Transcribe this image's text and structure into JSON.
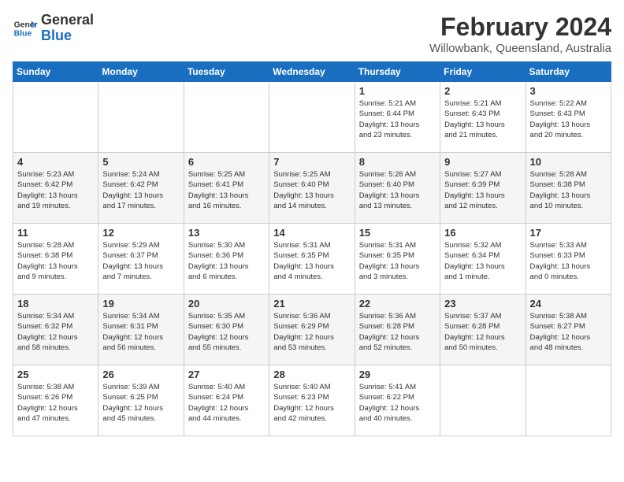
{
  "logo": {
    "line1": "General",
    "line2": "Blue"
  },
  "title": "February 2024",
  "location": "Willowbank, Queensland, Australia",
  "days_header": [
    "Sunday",
    "Monday",
    "Tuesday",
    "Wednesday",
    "Thursday",
    "Friday",
    "Saturday"
  ],
  "weeks": [
    [
      {
        "num": "",
        "info": ""
      },
      {
        "num": "",
        "info": ""
      },
      {
        "num": "",
        "info": ""
      },
      {
        "num": "",
        "info": ""
      },
      {
        "num": "1",
        "info": "Sunrise: 5:21 AM\nSunset: 6:44 PM\nDaylight: 13 hours\nand 23 minutes."
      },
      {
        "num": "2",
        "info": "Sunrise: 5:21 AM\nSunset: 6:43 PM\nDaylight: 13 hours\nand 21 minutes."
      },
      {
        "num": "3",
        "info": "Sunrise: 5:22 AM\nSunset: 6:43 PM\nDaylight: 13 hours\nand 20 minutes."
      }
    ],
    [
      {
        "num": "4",
        "info": "Sunrise: 5:23 AM\nSunset: 6:42 PM\nDaylight: 13 hours\nand 19 minutes."
      },
      {
        "num": "5",
        "info": "Sunrise: 5:24 AM\nSunset: 6:42 PM\nDaylight: 13 hours\nand 17 minutes."
      },
      {
        "num": "6",
        "info": "Sunrise: 5:25 AM\nSunset: 6:41 PM\nDaylight: 13 hours\nand 16 minutes."
      },
      {
        "num": "7",
        "info": "Sunrise: 5:25 AM\nSunset: 6:40 PM\nDaylight: 13 hours\nand 14 minutes."
      },
      {
        "num": "8",
        "info": "Sunrise: 5:26 AM\nSunset: 6:40 PM\nDaylight: 13 hours\nand 13 minutes."
      },
      {
        "num": "9",
        "info": "Sunrise: 5:27 AM\nSunset: 6:39 PM\nDaylight: 13 hours\nand 12 minutes."
      },
      {
        "num": "10",
        "info": "Sunrise: 5:28 AM\nSunset: 6:38 PM\nDaylight: 13 hours\nand 10 minutes."
      }
    ],
    [
      {
        "num": "11",
        "info": "Sunrise: 5:28 AM\nSunset: 6:38 PM\nDaylight: 13 hours\nand 9 minutes."
      },
      {
        "num": "12",
        "info": "Sunrise: 5:29 AM\nSunset: 6:37 PM\nDaylight: 13 hours\nand 7 minutes."
      },
      {
        "num": "13",
        "info": "Sunrise: 5:30 AM\nSunset: 6:36 PM\nDaylight: 13 hours\nand 6 minutes."
      },
      {
        "num": "14",
        "info": "Sunrise: 5:31 AM\nSunset: 6:35 PM\nDaylight: 13 hours\nand 4 minutes."
      },
      {
        "num": "15",
        "info": "Sunrise: 5:31 AM\nSunset: 6:35 PM\nDaylight: 13 hours\nand 3 minutes."
      },
      {
        "num": "16",
        "info": "Sunrise: 5:32 AM\nSunset: 6:34 PM\nDaylight: 13 hours\nand 1 minute."
      },
      {
        "num": "17",
        "info": "Sunrise: 5:33 AM\nSunset: 6:33 PM\nDaylight: 13 hours\nand 0 minutes."
      }
    ],
    [
      {
        "num": "18",
        "info": "Sunrise: 5:34 AM\nSunset: 6:32 PM\nDaylight: 12 hours\nand 58 minutes."
      },
      {
        "num": "19",
        "info": "Sunrise: 5:34 AM\nSunset: 6:31 PM\nDaylight: 12 hours\nand 56 minutes."
      },
      {
        "num": "20",
        "info": "Sunrise: 5:35 AM\nSunset: 6:30 PM\nDaylight: 12 hours\nand 55 minutes."
      },
      {
        "num": "21",
        "info": "Sunrise: 5:36 AM\nSunset: 6:29 PM\nDaylight: 12 hours\nand 53 minutes."
      },
      {
        "num": "22",
        "info": "Sunrise: 5:36 AM\nSunset: 6:28 PM\nDaylight: 12 hours\nand 52 minutes."
      },
      {
        "num": "23",
        "info": "Sunrise: 5:37 AM\nSunset: 6:28 PM\nDaylight: 12 hours\nand 50 minutes."
      },
      {
        "num": "24",
        "info": "Sunrise: 5:38 AM\nSunset: 6:27 PM\nDaylight: 12 hours\nand 48 minutes."
      }
    ],
    [
      {
        "num": "25",
        "info": "Sunrise: 5:38 AM\nSunset: 6:26 PM\nDaylight: 12 hours\nand 47 minutes."
      },
      {
        "num": "26",
        "info": "Sunrise: 5:39 AM\nSunset: 6:25 PM\nDaylight: 12 hours\nand 45 minutes."
      },
      {
        "num": "27",
        "info": "Sunrise: 5:40 AM\nSunset: 6:24 PM\nDaylight: 12 hours\nand 44 minutes."
      },
      {
        "num": "28",
        "info": "Sunrise: 5:40 AM\nSunset: 6:23 PM\nDaylight: 12 hours\nand 42 minutes."
      },
      {
        "num": "29",
        "info": "Sunrise: 5:41 AM\nSunset: 6:22 PM\nDaylight: 12 hours\nand 40 minutes."
      },
      {
        "num": "",
        "info": ""
      },
      {
        "num": "",
        "info": ""
      }
    ]
  ]
}
